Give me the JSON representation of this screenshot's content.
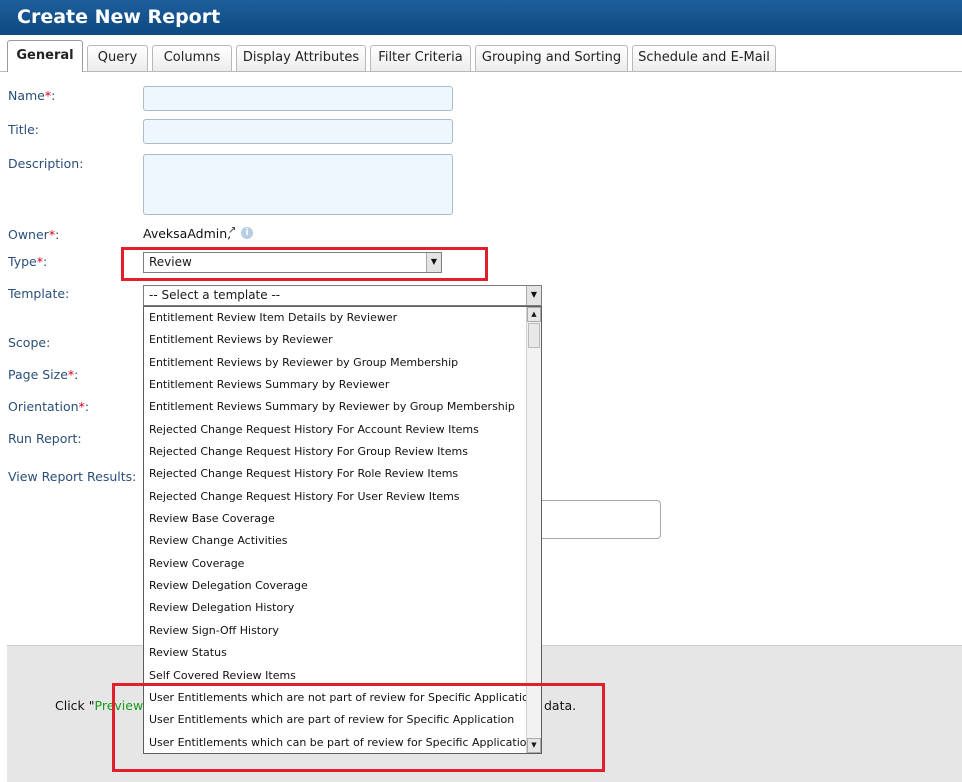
{
  "window": {
    "title": "Create New Report"
  },
  "tabs": [
    {
      "label": "General"
    },
    {
      "label": "Query"
    },
    {
      "label": "Columns"
    },
    {
      "label": "Display Attributes"
    },
    {
      "label": "Filter Criteria"
    },
    {
      "label": "Grouping and Sorting"
    },
    {
      "label": "Schedule and E-Mail"
    }
  ],
  "form": {
    "name_label": "Name",
    "title_label": "Title:",
    "description_label": "Description:",
    "owner_label": "Owner",
    "owner_value": "AveksaAdmin,",
    "type_label": "Type",
    "type_value": "Review",
    "template_label": "Template:",
    "template_placeholder": "-- Select a template --",
    "scope_label": "Scope:",
    "page_size_label": "Page Size",
    "orientation_label": "Orientation",
    "run_report_label": "Run Report:",
    "view_results_label": "View Report Results:",
    "required_mark": "*",
    "colon": ":"
  },
  "template_options": [
    "Entitlement Review Item Details by Reviewer",
    "Entitlement Reviews by Reviewer",
    "Entitlement Reviews by Reviewer by Group Membership",
    "Entitlement Reviews Summary by Reviewer",
    "Entitlement Reviews Summary by Reviewer by Group Membership",
    "Rejected Change Request History For Account Review Items",
    "Rejected Change Request History For Group Review Items",
    "Rejected Change Request History For Role Review Items",
    "Rejected Change Request History For User Review Items",
    "Review Base Coverage",
    "Review Change Activities",
    "Review Coverage",
    "Review Delegation Coverage",
    "Review Delegation History",
    "Review Sign-Off History",
    "Review Status",
    "Self Covered Review Items",
    "User Entitlements which are not part of review for Specific Application",
    "User Entitlements which are part of review for Specific Application",
    "User Entitlements which can be part of review for Specific Application"
  ],
  "preview": {
    "prefix": "Click \"",
    "link": "Preview",
    "suffix": "\"",
    "tail": "data."
  },
  "icons": {
    "external_link": "external-link-icon",
    "info": "info-icon",
    "dropdown": "chevron-down-icon"
  },
  "colors": {
    "title_bar": "#0e4880",
    "label": "#2a4f7a",
    "required": "#d9001b",
    "highlight_box": "#e0212b",
    "preview_link": "#1b9a1b"
  }
}
